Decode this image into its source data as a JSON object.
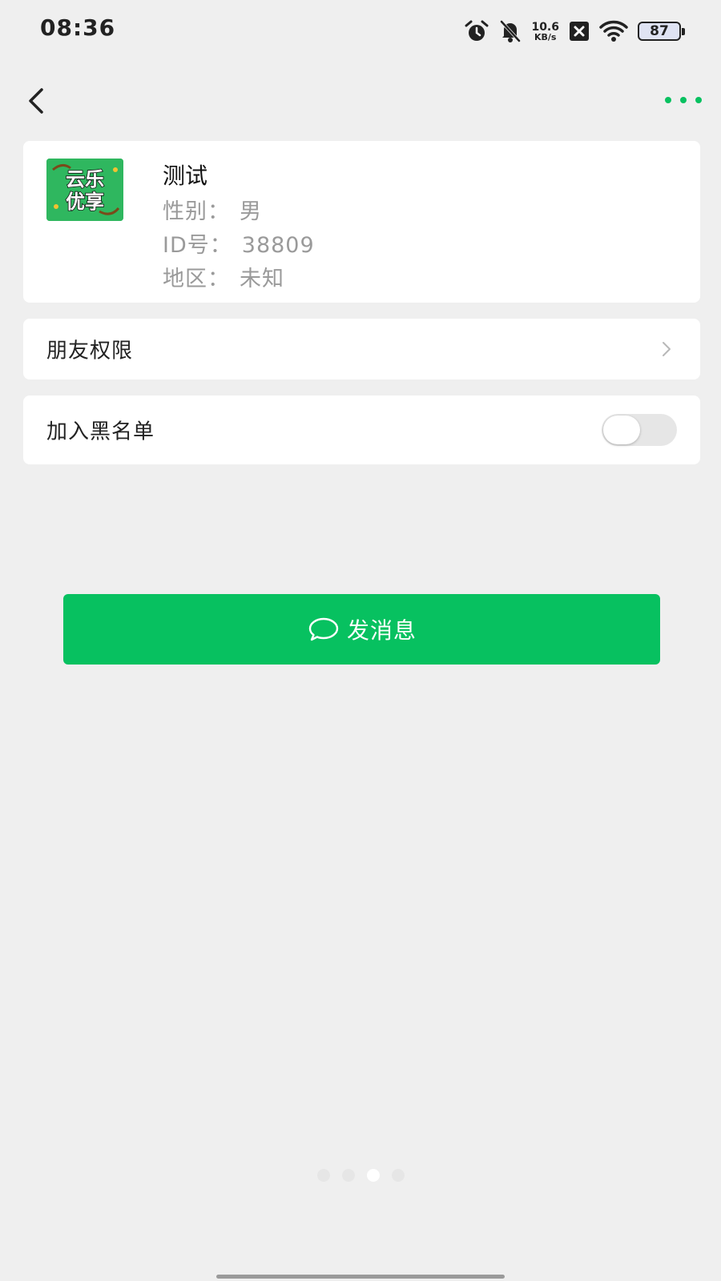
{
  "status_bar": {
    "time": "08:36",
    "net_speed_value": "10.6",
    "net_speed_unit": "KB/s",
    "battery": "87",
    "icons": [
      "alarm-icon",
      "mute-bell-icon",
      "x-app-icon",
      "wifi-icon",
      "battery-icon"
    ]
  },
  "nav": {
    "back_icon": "chevron-left-icon",
    "more_icon": "more-dots-icon"
  },
  "profile": {
    "avatar_text_line1": "云乐",
    "avatar_text_line2": "优享",
    "name": "测试",
    "gender_label": "性别：",
    "gender_value": "男",
    "id_label": "ID号：",
    "id_value": "38809",
    "region_label": "地区：",
    "region_value": "未知"
  },
  "settings": {
    "friend_permission_label": "朋友权限",
    "blacklist_label": "加入黑名单",
    "blacklist_enabled": false
  },
  "send_button": {
    "label": "发消息",
    "icon": "chat-bubble-icon"
  },
  "pager": {
    "count": 4,
    "active_index": 2
  },
  "colors": {
    "accent": "#07c160",
    "background": "#efefef",
    "card": "#ffffff",
    "secondary_text": "#9a9a9a"
  }
}
